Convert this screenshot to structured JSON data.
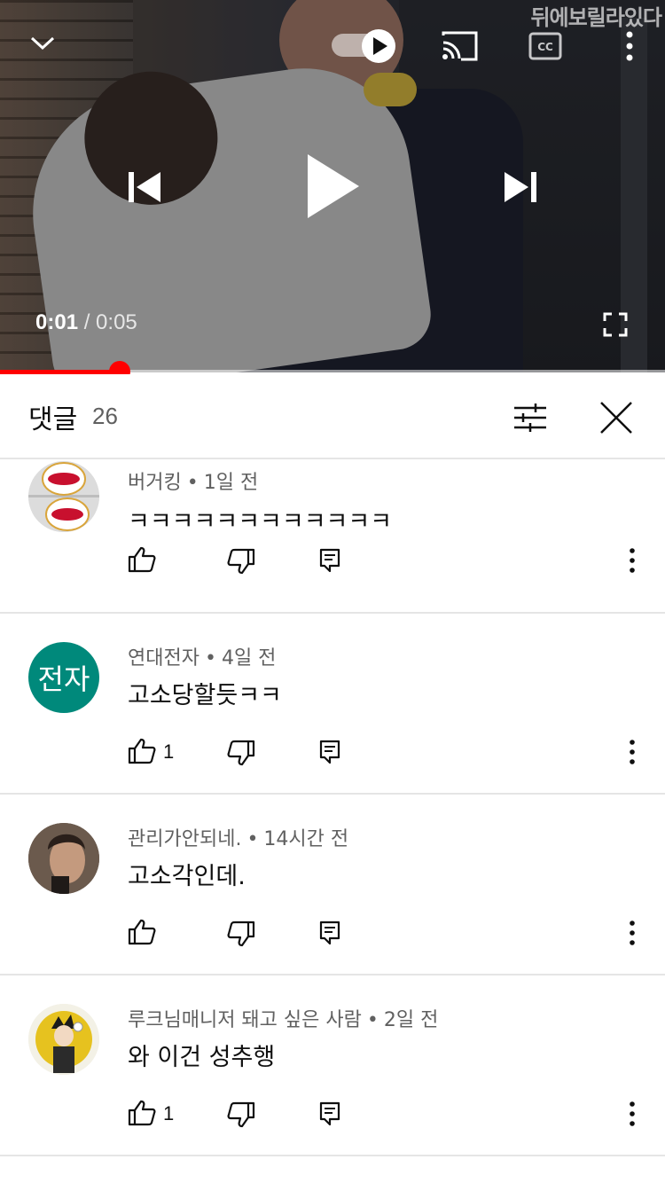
{
  "player": {
    "watermark": "뒤에보릴라있다",
    "current_time": "0:01",
    "total_time": "/ 0:05",
    "progress_fraction": 0.18,
    "progress_color": "#ff0000",
    "autoplay_on": true,
    "icons": [
      "chevron-down-icon",
      "autoplay-toggle",
      "cast-icon",
      "captions-icon",
      "more-vert-icon",
      "previous-icon",
      "play-icon",
      "next-icon",
      "fullscreen-icon"
    ]
  },
  "comments_header": {
    "title": "댓글",
    "count": "26",
    "icons": [
      "sort-filter-icon",
      "close-icon"
    ]
  },
  "comments": [
    {
      "author": "버거킹",
      "time": "1일 전",
      "text": "ㅋㅋㅋㅋㅋㅋㅋㅋㅋㅋㅋㅋ",
      "likes": "",
      "avatar_kind": "image",
      "avatar_label": "BURGER KING"
    },
    {
      "author": "연대전자",
      "time": "4일 전",
      "text": "고소당할듯ㅋㅋ",
      "likes": "1",
      "avatar_kind": "initials",
      "avatar_label": "전자",
      "avatar_color": "#00897b"
    },
    {
      "author": "관리가안되네.",
      "time": "14시간 전",
      "text": "고소각인데.",
      "likes": "",
      "avatar_kind": "image"
    },
    {
      "author": "루크님매니저 돼고 싶은 사람",
      "time": "2일 전",
      "text": "와 이건 성추행",
      "likes": "1",
      "avatar_kind": "image"
    }
  ],
  "comment_action_icons": [
    "thumb-up-icon",
    "thumb-down-icon",
    "reply-icon",
    "more-vert-icon"
  ]
}
